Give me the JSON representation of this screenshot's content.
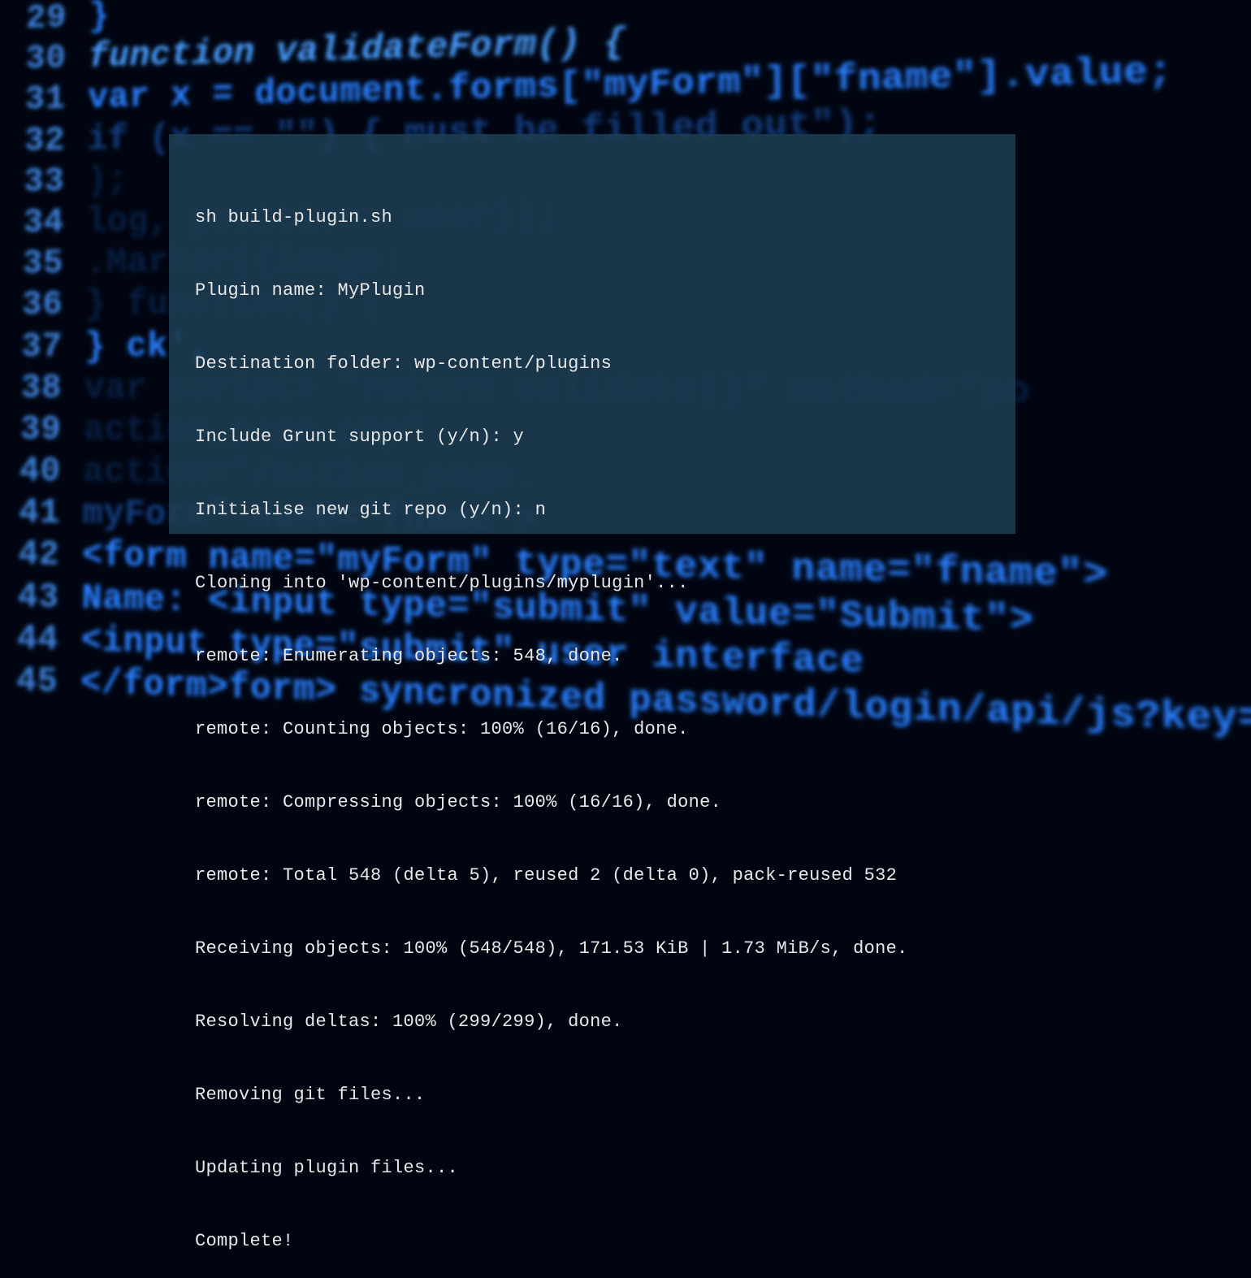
{
  "background_code": {
    "lines": [
      {
        "no": "29",
        "text": "        }"
      },
      {
        "no": "30",
        "text": "function validateForm() {"
      },
      {
        "no": "31",
        "text": "    var x = document.forms[\"myForm\"][\"fname\"].value;"
      },
      {
        "no": "32",
        "text": "    if (x == \"\") {         must be filled out\");"
      },
      {
        "no": "33",
        "text": "                                                                                        );"
      },
      {
        "no": "34",
        "text": "                                                                          log, position: user));"
      },
      {
        "no": "35",
        "text": "                                                .Marker({image:"
      },
      {
        "no": "36",
        "text": "    }                                     function() {"
      },
      {
        "no": "37",
        "text": "}                                   ck',"
      },
      {
        "no": "38",
        "text": "var                                             script>                              \"return validate()\"  method=\"po"
      },
      {
        "no": "39",
        "text": "                                                        action_page.php\""
      },
      {
        "no": "40",
        "text": "                              action=\"/action_page."
      },
      {
        "no": "41",
        "text": "                   myForm\"           name=\"fname\">"
      },
      {
        "no": "42",
        "text": "<form name=\"myForm\"  type=\"text\" name=\"fname\">"
      },
      {
        "no": "43",
        "text": "   Name: <input type=\"submit\" value=\"Submit\">"
      },
      {
        "no": "44",
        "text": "   <input type=\"submit\"     user interface"
      },
      {
        "no": "45",
        "text": "   </form>form>   syncronized  password/login/api/js?key=\">;"
      }
    ]
  },
  "terminal": {
    "lines": [
      "sh build-plugin.sh",
      "Plugin name: MyPlugin",
      "Destination folder: wp-content/plugins",
      "Include Grunt support (y/n): y",
      "Initialise new git repo (y/n): n",
      "Cloning into 'wp-content/plugins/myplugin'...",
      "remote: Enumerating objects: 548, done.",
      "remote: Counting objects: 100% (16/16), done.",
      "remote: Compressing objects: 100% (16/16), done.",
      "remote: Total 548 (delta 5), reused 2 (delta 0), pack-reused 532",
      "Receiving objects: 100% (548/548), 171.53 KiB | 1.73 MiB/s, done.",
      "Resolving deltas: 100% (299/299), done.",
      "Removing git files...",
      "Updating plugin files...",
      "Complete!"
    ]
  }
}
